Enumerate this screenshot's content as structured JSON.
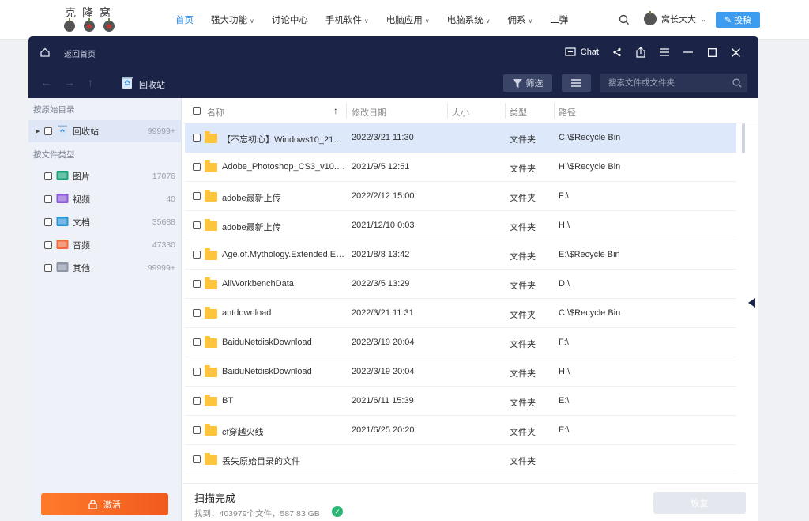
{
  "site": {
    "logo_text": "克隆窝",
    "nav": [
      {
        "label": "首页",
        "active": true,
        "dropdown": false
      },
      {
        "label": "强大功能",
        "active": false,
        "dropdown": true
      },
      {
        "label": "讨论中心",
        "active": false,
        "dropdown": false
      },
      {
        "label": "手机软件",
        "active": false,
        "dropdown": true
      },
      {
        "label": "电脑应用",
        "active": false,
        "dropdown": true
      },
      {
        "label": "电脑系统",
        "active": false,
        "dropdown": true
      },
      {
        "label": "佣系",
        "active": false,
        "dropdown": true
      },
      {
        "label": "二弹",
        "active": false,
        "dropdown": false
      }
    ],
    "user_name": "窝长大大",
    "post_button": "投稿",
    "accent": "#2b8ce6"
  },
  "app": {
    "titlebar": {
      "back_home": "返回首页",
      "chat": "Chat"
    },
    "toolbar": {
      "location": "回收站",
      "filter": "筛选",
      "search_placeholder": "搜索文件或文件夹"
    },
    "sidebar": {
      "by_dir_heading": "按原始目录",
      "dir_items": [
        {
          "label": "回收站",
          "count": "99999+",
          "icon": "recycle-bin-icon"
        }
      ],
      "by_type_heading": "按文件类型",
      "type_items": [
        {
          "label": "图片",
          "count": "17076",
          "icon": "image-icon",
          "color": "#1aa37a"
        },
        {
          "label": "视频",
          "count": "40",
          "icon": "video-icon",
          "color": "#8a5cd6"
        },
        {
          "label": "文档",
          "count": "35688",
          "icon": "document-icon",
          "color": "#2a95d8"
        },
        {
          "label": "音频",
          "count": "47330",
          "icon": "audio-icon",
          "color": "#ef6a3c"
        },
        {
          "label": "其他",
          "count": "99999+",
          "icon": "other-icon",
          "color": "#8e96a6"
        }
      ],
      "activate": "激活"
    },
    "table": {
      "columns": {
        "name": "名称",
        "date": "修改日期",
        "size": "大小",
        "type": "类型",
        "path": "路径"
      },
      "rows": [
        {
          "name": "【不忘初心】Windows10_21H2...",
          "date": "2022/3/21 11:30",
          "type": "文件夹",
          "path": "C:\\$Recycle Bin"
        },
        {
          "name": "Adobe_Photoshop_CS3_v10.0_...",
          "date": "2021/9/5 12:51",
          "type": "文件夹",
          "path": "H:\\$Recycle Bin"
        },
        {
          "name": "adobe最新上传",
          "date": "2022/2/12 15:00",
          "type": "文件夹",
          "path": "F:\\"
        },
        {
          "name": "adobe最新上传",
          "date": "2021/12/10 0:03",
          "type": "文件夹",
          "path": "H:\\"
        },
        {
          "name": "Age.of.Mythology.Extended.Edi...",
          "date": "2021/8/8 13:42",
          "type": "文件夹",
          "path": "E:\\$Recycle Bin"
        },
        {
          "name": "AliWorkbenchData",
          "date": "2022/3/5 13:29",
          "type": "文件夹",
          "path": "D:\\"
        },
        {
          "name": "antdownload",
          "date": "2022/3/21 11:31",
          "type": "文件夹",
          "path": "C:\\$Recycle Bin"
        },
        {
          "name": "BaiduNetdiskDownload",
          "date": "2022/3/19 20:04",
          "type": "文件夹",
          "path": "F:\\"
        },
        {
          "name": "BaiduNetdiskDownload",
          "date": "2022/3/19 20:04",
          "type": "文件夹",
          "path": "H:\\"
        },
        {
          "name": "BT",
          "date": "2021/6/11 15:39",
          "type": "文件夹",
          "path": "E:\\"
        },
        {
          "name": "cf穿越火线",
          "date": "2021/6/25 20:20",
          "type": "文件夹",
          "path": "E:\\"
        },
        {
          "name": "丢失原始目录的文件",
          "date": "",
          "type": "文件夹",
          "path": ""
        }
      ]
    },
    "footer": {
      "status": "扫描完成",
      "found": "找到：403979个文件，587.83 GB",
      "restore": "恢复"
    }
  }
}
